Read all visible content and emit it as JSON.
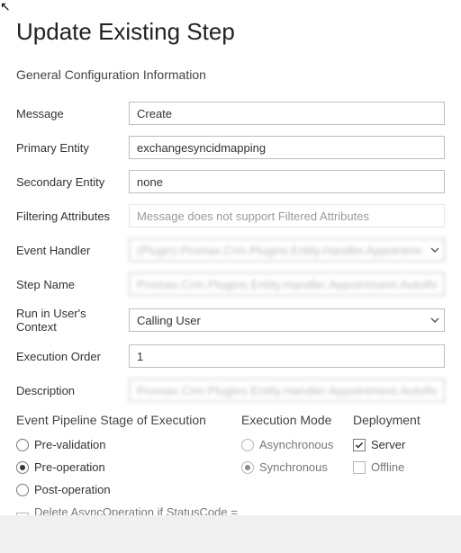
{
  "title": "Update Existing Step",
  "section_heading": "General Configuration Information",
  "fields": {
    "message": {
      "label": "Message",
      "value": "Create"
    },
    "primary_entity": {
      "label": "Primary Entity",
      "value": "exchangesyncidmapping"
    },
    "secondary_entity": {
      "label": "Secondary Entity",
      "value": "none"
    },
    "filtering_attrs": {
      "label": "Filtering Attributes",
      "value": "",
      "placeholder": "Message does not support Filtered Attributes"
    },
    "event_handler": {
      "label": "Event Handler",
      "value": "(Plugin) Promax.Crm.Plugins.Entity.Handler.Appointment.Auto…"
    },
    "step_name": {
      "label": "Step Name",
      "value": "Promax.Crm.Plugins.Entity.Handler.Appointment.AutoResolveOnCr…"
    },
    "run_context": {
      "label": "Run in User's Context",
      "value": "Calling User"
    },
    "execution_order": {
      "label": "Execution Order",
      "value": "1"
    },
    "description": {
      "label": "Description",
      "value": "Promax.Crm.Plugins.Entity.Handler.Appointment.AutoResolveOnCr…"
    }
  },
  "stage": {
    "heading": "Event Pipeline Stage of Execution",
    "options": {
      "pre_validation": "Pre-validation",
      "pre_operation": "Pre-operation",
      "post_operation": "Post-operation"
    },
    "selected": "pre_operation",
    "delete_async_label": "Delete AsyncOperation if StatusCode = Successful",
    "delete_async_checked": false
  },
  "mode": {
    "heading": "Execution Mode",
    "options": {
      "asynchronous": "Asynchronous",
      "synchronous": "Synchronous"
    },
    "selected": "synchronous",
    "enabled": false
  },
  "deployment": {
    "heading": "Deployment",
    "server": {
      "label": "Server",
      "checked": true,
      "enabled": true
    },
    "offline": {
      "label": "Offline",
      "checked": false,
      "enabled": false
    }
  }
}
